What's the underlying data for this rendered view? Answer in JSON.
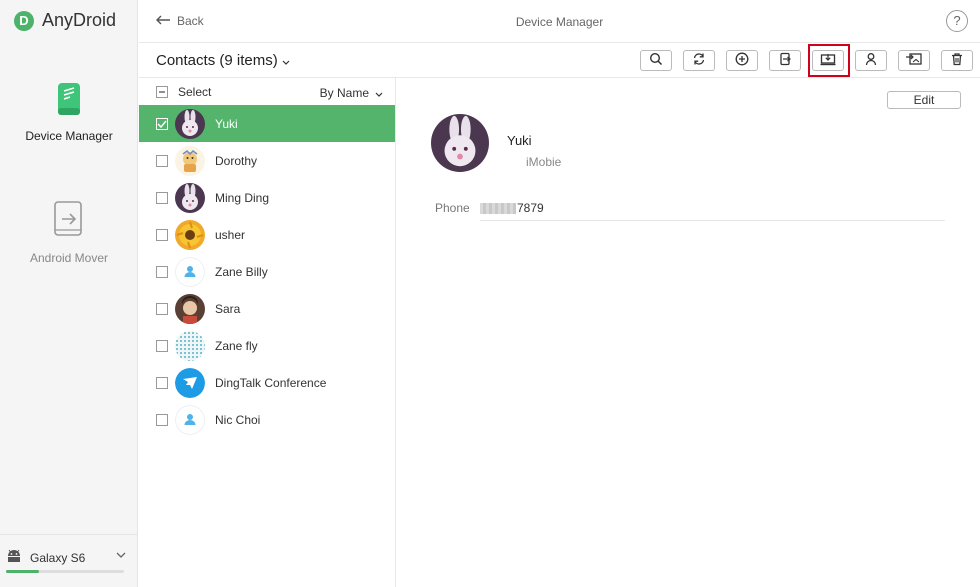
{
  "app": {
    "name": "AnyDroid",
    "logo_letter": "D"
  },
  "sidebar": {
    "items": [
      {
        "label": "Device Manager",
        "icon": "phone-icon",
        "active": true
      },
      {
        "label": "Android Mover",
        "icon": "transfer-icon",
        "active": false
      }
    ],
    "device": {
      "name": "Galaxy S6",
      "storage_fraction": 0.28
    }
  },
  "topbar": {
    "back_label": "Back",
    "title": "Device Manager",
    "help_label": "?"
  },
  "toolbar": {
    "title": "Contacts (9 items)",
    "buttons": [
      "search-icon",
      "refresh-icon",
      "add-icon",
      "export-to-device-icon",
      "export-to-computer-icon",
      "add-contact-icon",
      "import-icon",
      "delete-icon"
    ],
    "highlighted": "export-to-computer-icon"
  },
  "list": {
    "select_label": "Select",
    "sort_label": "By Name",
    "contacts": [
      {
        "name": "Yuki",
        "selected": true
      },
      {
        "name": "Dorothy",
        "selected": false
      },
      {
        "name": "Ming Ding",
        "selected": false
      },
      {
        "name": "usher",
        "selected": false
      },
      {
        "name": "Zane Billy",
        "selected": false
      },
      {
        "name": "Sara",
        "selected": false
      },
      {
        "name": "Zane fly",
        "selected": false
      },
      {
        "name": "DingTalk Conference",
        "selected": false
      },
      {
        "name": "Nic Choi",
        "selected": false
      }
    ]
  },
  "detail": {
    "edit_label": "Edit",
    "name": "Yuki",
    "company": "iMobie",
    "phone_label": "Phone",
    "phone_suffix": "7879"
  },
  "colors": {
    "accent": "#54b46c",
    "highlight": "#d0021b"
  }
}
